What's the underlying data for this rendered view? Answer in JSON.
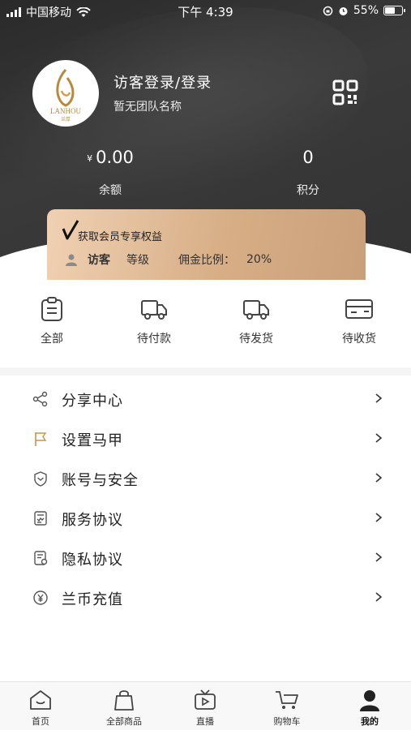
{
  "status_bar": {
    "carrier": "中国移动",
    "time": "下午 4:39",
    "battery": "55%"
  },
  "profile": {
    "logo_text": "LANHOU",
    "logo_sub": "兰厚",
    "name": "访客登录/登录",
    "team": "暂无团队名称"
  },
  "stats": {
    "balance_symbol": "¥",
    "balance_value": "0.00",
    "balance_label": "余额",
    "points_value": "0",
    "points_label": "积分"
  },
  "vip": {
    "title": "获取会员专享权益",
    "user": "访客",
    "level_label": "等级",
    "commission_label": "佣金比例：",
    "commission_value": "20%"
  },
  "orders": [
    {
      "label": "全部",
      "icon": "clipboard-icon"
    },
    {
      "label": "待付款",
      "icon": "truck-icon"
    },
    {
      "label": "待发货",
      "icon": "truck-icon"
    },
    {
      "label": "待收货",
      "icon": "card-icon"
    }
  ],
  "menu": [
    {
      "label": "分享中心",
      "icon": "share-icon"
    },
    {
      "label": "设置马甲",
      "icon": "flag-icon"
    },
    {
      "label": "账号与安全",
      "icon": "shield-icon"
    },
    {
      "label": "服务协议",
      "icon": "document-icon"
    },
    {
      "label": "隐私协议",
      "icon": "privacy-doc-icon"
    },
    {
      "label": "兰币充值",
      "icon": "yen-coin-icon"
    }
  ],
  "tabs": [
    {
      "label": "首页",
      "icon": "home-icon"
    },
    {
      "label": "全部商品",
      "icon": "bag-icon"
    },
    {
      "label": "直播",
      "icon": "tv-icon"
    },
    {
      "label": "购物车",
      "icon": "cart-icon"
    },
    {
      "label": "我的",
      "icon": "person-icon",
      "active": true
    }
  ],
  "colors": {
    "header": "#333333",
    "vip_gold": "#d7ae86",
    "text": "#222222"
  }
}
